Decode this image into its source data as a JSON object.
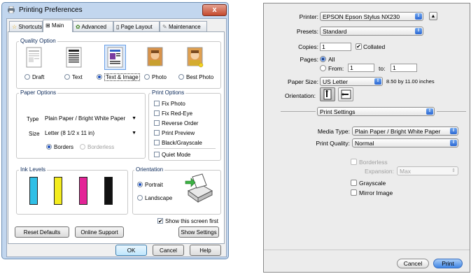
{
  "win": {
    "title": "Printing Preferences",
    "close_label": "x",
    "tabs": [
      {
        "label": "Shortcuts"
      },
      {
        "label": "Main"
      },
      {
        "label": "Advanced"
      },
      {
        "label": "Page Layout"
      },
      {
        "label": "Maintenance"
      }
    ],
    "quality": {
      "title": "Quality Option",
      "options": [
        "Draft",
        "Text",
        "Text & Image",
        "Photo",
        "Best Photo"
      ],
      "selected": "Text & Image"
    },
    "paper": {
      "title": "Paper Options",
      "type_label": "Type",
      "type_value": "Plain Paper / Bright White Paper",
      "size_label": "Size",
      "size_value": "Letter (8 1/2 x 11 in)",
      "borders_label": "Borders",
      "borderless_label": "Borderless"
    },
    "print_options": {
      "title": "Print Options",
      "items": [
        "Fix Photo",
        "Fix Red-Eye",
        "Reverse Order",
        "Print Preview",
        "Black/Grayscale"
      ],
      "quiet_mode": "Quiet Mode"
    },
    "ink": {
      "title": "Ink Levels",
      "colors": [
        "#30bfe6",
        "#f4ec1e",
        "#e32497",
        "#111111"
      ]
    },
    "orientation": {
      "title": "Orientation",
      "portrait": "Portrait",
      "landscape": "Landscape"
    },
    "show_screen_first": "Show this screen first",
    "buttons": {
      "reset": "Reset Defaults",
      "support": "Online Support",
      "show_settings": "Show Settings",
      "ok": "OK",
      "cancel": "Cancel",
      "help": "Help"
    }
  },
  "mac": {
    "printer_label": "Printer:",
    "printer_value": "EPSON Epson Stylus NX230",
    "presets_label": "Presets:",
    "presets_value": "Standard",
    "copies_label": "Copies:",
    "copies_value": "1",
    "collated_label": "Collated",
    "pages_label": "Pages:",
    "all_label": "All",
    "from_label": "From:",
    "from_value": "1",
    "to_label": "to:",
    "to_value": "1",
    "paper_size_label": "Paper Size:",
    "paper_size_value": "US Letter",
    "paper_size_dims": "8.50 by 11.00 inches",
    "orientation_label": "Orientation:",
    "section_value": "Print Settings",
    "media_type_label": "Media Type:",
    "media_type_value": "Plain Paper / Bright White Paper",
    "print_quality_label": "Print Quality:",
    "print_quality_value": "Normal",
    "borderless_label": "Borderless",
    "expansion_label": "Expansion:",
    "expansion_value": "Max",
    "grayscale_label": "Grayscale",
    "mirror_label": "Mirror Image",
    "cancel_label": "Cancel",
    "print_label": "Print"
  }
}
